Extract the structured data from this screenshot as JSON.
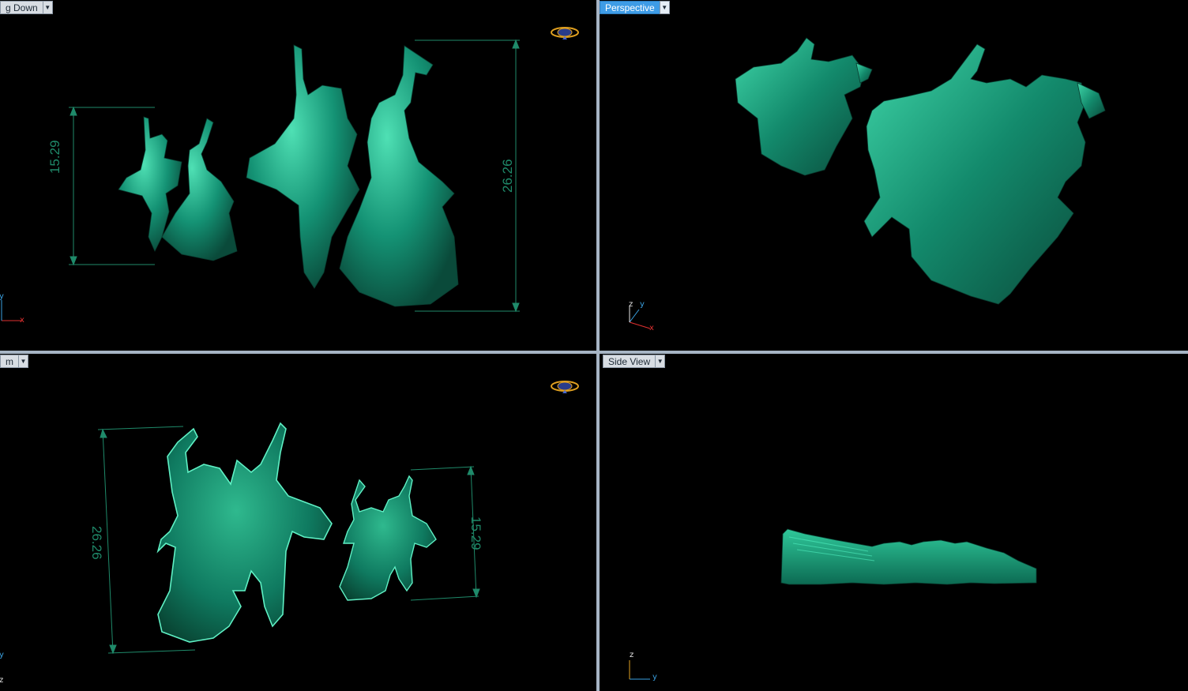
{
  "viewports": {
    "top_left": {
      "label": "g Down",
      "dimension_small": "15.29",
      "dimension_large": "26.26"
    },
    "top_right": {
      "label": "Perspective"
    },
    "bottom_left": {
      "label": "m",
      "dimension_small": "15.29",
      "dimension_large": "26.26"
    },
    "bottom_right": {
      "label": "Side View"
    }
  },
  "axes": {
    "x": "x",
    "y": "y",
    "z": "z"
  },
  "icons": {
    "dropdown": "chevron-down-icon",
    "navigator": "orbit-ring-icon"
  },
  "colors": {
    "model": "#149274",
    "model_highlight": "#3fd6a8",
    "dimension": "#1f8a6a",
    "active_tab": "#3e9ce6",
    "axis_x": "#e03030",
    "axis_y": "#3aa0e0",
    "axis_z": "#e8e8e8"
  }
}
